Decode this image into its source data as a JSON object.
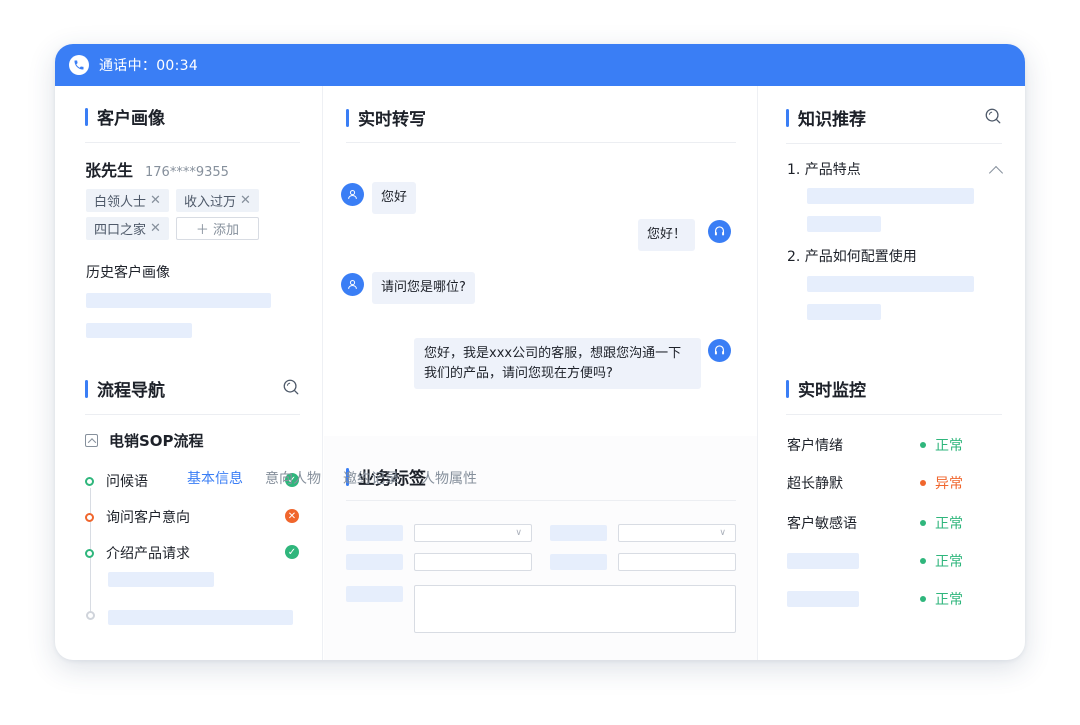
{
  "call_bar": {
    "status_text": "通话中：00:34",
    "icon": "phone-icon"
  },
  "customer_profile": {
    "title": "客户画像",
    "name": "张先生",
    "phone": "176****9355",
    "tags": [
      {
        "label": "白领人士",
        "remove": "✕"
      },
      {
        "label": "收入过万",
        "remove": "✕"
      },
      {
        "label": "四口之家",
        "remove": "✕"
      }
    ],
    "add_tag_label": "＋ 添加",
    "history_label": "历史客户画像"
  },
  "process_nav": {
    "title": "流程导航",
    "flow_name": "电销SOP流程",
    "steps": [
      {
        "label": "问候语",
        "status": "done",
        "status_glyph": "✓"
      },
      {
        "label": "询问客户意向",
        "status": "failed",
        "status_glyph": "✕"
      },
      {
        "label": "介绍产品请求",
        "status": "done",
        "status_glyph": "✓"
      }
    ]
  },
  "transcript": {
    "title": "实时转写",
    "messages": [
      {
        "role": "customer",
        "text": "您好"
      },
      {
        "role": "agent",
        "text": "您好！"
      },
      {
        "role": "customer",
        "text": "请问您是哪位?"
      },
      {
        "role": "agent",
        "text_line1": "您好，我是xxx公司的客服，想跟您沟通一下",
        "text_line2": "我们的产品，请问您现在方便吗?"
      }
    ]
  },
  "business_tags": {
    "title": "业务标签",
    "tabs": [
      "基本信息",
      "意向人物",
      "邀约记录",
      "人物属性"
    ],
    "active_tab": "基本信息"
  },
  "knowledge": {
    "title": "知识推荐",
    "items": [
      "1. 产品特点",
      "2. 产品如何配置使用"
    ]
  },
  "monitor": {
    "title": "实时监控",
    "rows": [
      {
        "label": "客户情绪",
        "status": "正常",
        "state": "ok"
      },
      {
        "label": "超长静默",
        "status": "异常",
        "state": "warn"
      },
      {
        "label": "客户敏感语",
        "status": "正常",
        "state": "ok"
      },
      {
        "label": "",
        "status": "正常",
        "state": "ok"
      },
      {
        "label": "",
        "status": "正常",
        "state": "ok"
      }
    ]
  },
  "colors": {
    "accent": "#3a7ef5",
    "ok": "#2fb67c",
    "warn": "#f0662d",
    "placeholder": "#e6eefc"
  }
}
